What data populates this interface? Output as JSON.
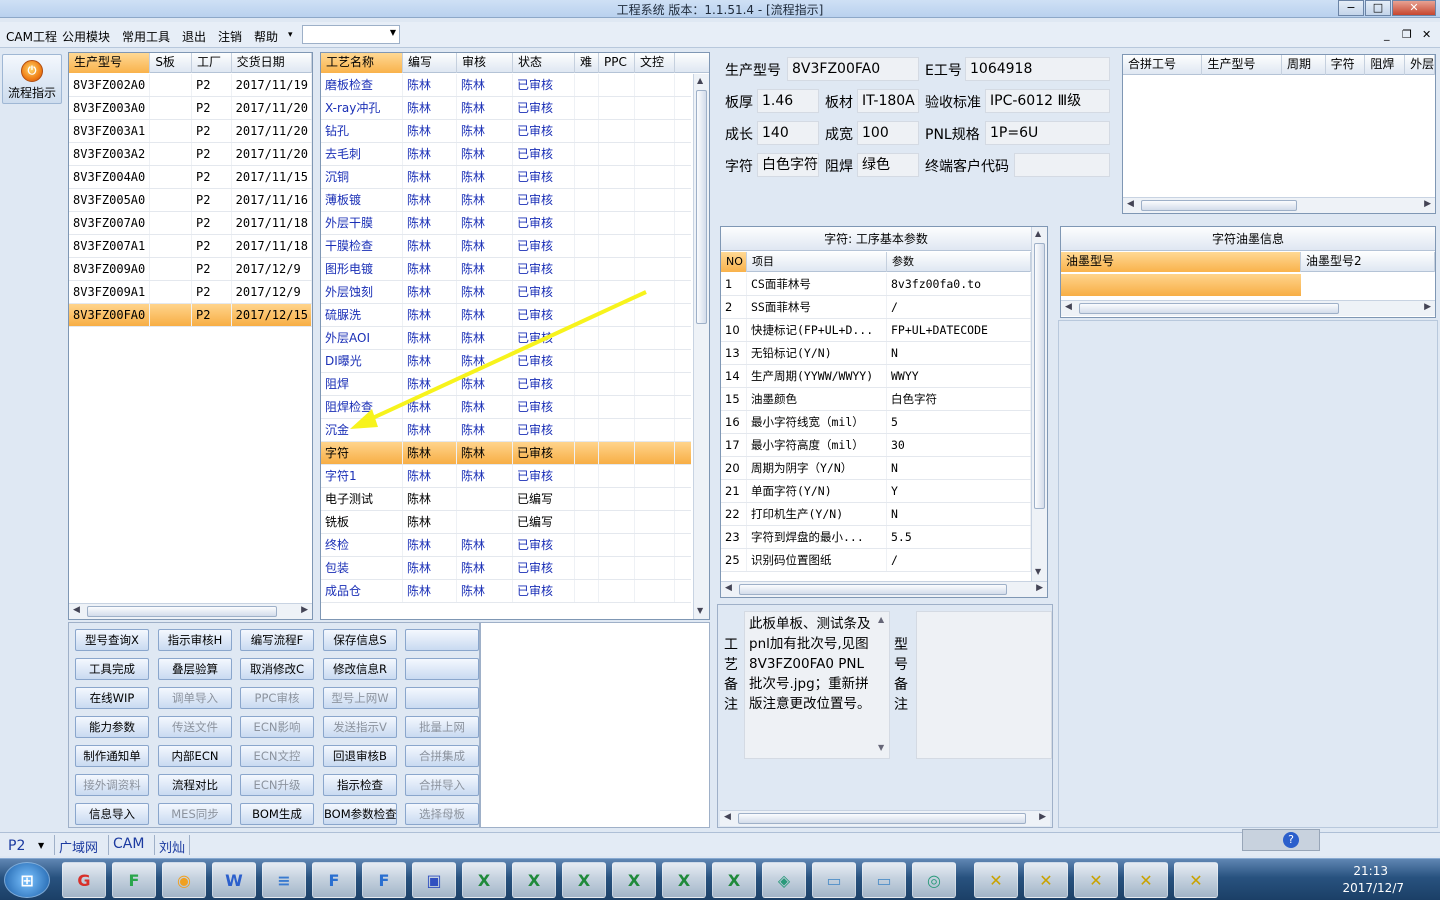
{
  "window": {
    "title": "工程系统    版本：1.1.51.4 - [流程指示]",
    "btn_min": "−",
    "btn_max": "□",
    "btn_close": "✕"
  },
  "menu": {
    "items": [
      "CAM工程",
      "公用模块",
      "常用工具",
      "退出",
      "注销",
      "帮助"
    ],
    "help_arrow": "▾",
    "combo_value": "",
    "mdi_min": "_",
    "mdi_restore": "❐",
    "mdi_close": "✕"
  },
  "nav": {
    "flow_label": "流程指示",
    "flow_icon": "flow-indicator-icon"
  },
  "models": {
    "headers": [
      "生产型号",
      "S板",
      "工厂",
      "交货日期"
    ],
    "rows": [
      [
        "8V3FZ002A0",
        "",
        "P2",
        "2017/11/19"
      ],
      [
        "8V3FZ003A0",
        "",
        "P2",
        "2017/11/20"
      ],
      [
        "8V3FZ003A1",
        "",
        "P2",
        "2017/11/20"
      ],
      [
        "8V3FZ003A2",
        "",
        "P2",
        "2017/11/20"
      ],
      [
        "8V3FZ004A0",
        "",
        "P2",
        "2017/11/15"
      ],
      [
        "8V3FZ005A0",
        "",
        "P2",
        "2017/11/16"
      ],
      [
        "8V3FZ007A0",
        "",
        "P2",
        "2017/11/18"
      ],
      [
        "8V3FZ007A1",
        "",
        "P2",
        "2017/11/18"
      ],
      [
        "8V3FZ009A0",
        "",
        "P2",
        "2017/12/9"
      ],
      [
        "8V3FZ009A1",
        "",
        "P2",
        "2017/12/9"
      ],
      [
        "8V3FZ00FA0",
        "",
        "P2",
        "2017/12/15"
      ]
    ],
    "selected_index": 10
  },
  "process": {
    "headers": [
      "工艺名称",
      "编写",
      "审核",
      "状态",
      "难",
      "PPC",
      "文控"
    ],
    "rows": [
      [
        "磨板检查",
        "陈林",
        "陈林",
        "已审核"
      ],
      [
        "X-ray冲孔",
        "陈林",
        "陈林",
        "已审核"
      ],
      [
        "钻孔",
        "陈林",
        "陈林",
        "已审核"
      ],
      [
        "去毛刺",
        "陈林",
        "陈林",
        "已审核"
      ],
      [
        "沉铜",
        "陈林",
        "陈林",
        "已审核"
      ],
      [
        "薄板镀",
        "陈林",
        "陈林",
        "已审核"
      ],
      [
        "外层干膜",
        "陈林",
        "陈林",
        "已审核"
      ],
      [
        "干膜检查",
        "陈林",
        "陈林",
        "已审核"
      ],
      [
        "图形电镀",
        "陈林",
        "陈林",
        "已审核"
      ],
      [
        "外层蚀刻",
        "陈林",
        "陈林",
        "已审核"
      ],
      [
        "硫脲洗",
        "陈林",
        "陈林",
        "已审核"
      ],
      [
        "外层AOI",
        "陈林",
        "陈林",
        "已审核"
      ],
      [
        "DI曝光",
        "陈林",
        "陈林",
        "已审核"
      ],
      [
        "阻焊",
        "陈林",
        "陈林",
        "已审核"
      ],
      [
        "阻焊检查",
        "陈林",
        "陈林",
        "已审核"
      ],
      [
        "沉金",
        "陈林",
        "陈林",
        "已审核"
      ],
      [
        "字符",
        "陈林",
        "陈林",
        "已审核"
      ],
      [
        "字符1",
        "陈林",
        "陈林",
        "已审核"
      ],
      [
        "电子测试",
        "陈林",
        "",
        "已编写"
      ],
      [
        "铣板",
        "陈林",
        "",
        "已编写"
      ],
      [
        "终检",
        "陈林",
        "陈林",
        "已审核"
      ],
      [
        "包装",
        "陈林",
        "陈林",
        "已审核"
      ],
      [
        "成品仓",
        "陈林",
        "陈林",
        "已审核"
      ]
    ],
    "selected_index": 16,
    "black_name_indices": [
      18,
      19
    ]
  },
  "buttons": [
    [
      "型号查询X",
      "指示审核H",
      "编写流程F",
      "保存信息S",
      ""
    ],
    [
      "工具完成",
      "叠层验算",
      "取消修改C",
      "修改信息R",
      ""
    ],
    [
      "在线WIP",
      "调单导入",
      "PPC审核",
      "型号上网W",
      ""
    ],
    [
      "能力参数",
      "传送文件",
      "ECN影响",
      "发送指示V",
      "批量上网"
    ],
    [
      "制作通知单",
      "内部ECN",
      "ECN文控",
      "回退审核B",
      "合拼集成"
    ],
    [
      "接外调资料",
      "流程对比",
      "ECN升级",
      "指示检查",
      "合拼导入"
    ],
    [
      "信息导入",
      "MES同步",
      "BOM生成",
      "BOM参数检查",
      "选择母板"
    ]
  ],
  "disabled_buttons": [
    "调单导入",
    "PPC审核",
    "型号上网W",
    "传送文件",
    "ECN影响",
    "发送指示V",
    "批量上网",
    "ECN文控",
    "合拼集成",
    "接外调资料",
    "ECN升级",
    "合拼导入",
    "MES同步",
    "选择母板"
  ],
  "info": {
    "model_label": "生产型号",
    "model": "8V3FZ00FA0",
    "eno_label": "E工号",
    "eno": "1064918",
    "thick_label": "板厚",
    "thick": "1.46",
    "mat_label": "板材",
    "mat": "IT-180A",
    "std_label": "验收标准",
    "std": "IPC-6012 Ⅲ级",
    "len_label": "成长",
    "len": "140",
    "wid_label": "成宽",
    "wid": "100",
    "pnl_label": "PNL规格",
    "pnl": "1P=6U",
    "char_label": "字符",
    "char": "白色字符",
    "mask_label": "阻焊",
    "mask": "绿色",
    "cust_label": "终端客户代码",
    "cust": ""
  },
  "merge": {
    "headers": [
      "合拼工号",
      "生产型号",
      "周期",
      "字符",
      "阻焊",
      "外层"
    ]
  },
  "params": {
    "title": "字符: 工序基本参数",
    "headers": [
      "NO",
      "项目",
      "参数"
    ],
    "rows": [
      [
        "1",
        "CS面菲林号",
        "8v3fz00fa0.to"
      ],
      [
        "2",
        "SS面菲林号",
        "/"
      ],
      [
        "10",
        "快捷标记(FP+UL+D...",
        "FP+UL+DATECODE"
      ],
      [
        "13",
        "无铅标记(Y/N)",
        "N"
      ],
      [
        "14",
        "生产周期(YYWW/WWYY)",
        "WWYY"
      ],
      [
        "15",
        "油墨颜色",
        "白色字符"
      ],
      [
        "16",
        "最小字符线宽（mil）",
        "5"
      ],
      [
        "17",
        "最小字符高度（mil）",
        "30"
      ],
      [
        "20",
        "周期为阴字（Y/N）",
        "N"
      ],
      [
        "21",
        "单面字符(Y/N)",
        "Y"
      ],
      [
        "22",
        "打印机生产(Y/N)",
        "N"
      ],
      [
        "23",
        "字符到焊盘的最小...",
        "5.5"
      ],
      [
        "25",
        "识别码位置图纸",
        "/"
      ]
    ]
  },
  "ink": {
    "title": "字符油墨信息",
    "headers": [
      "油墨型号",
      "油墨型号2"
    ]
  },
  "remarks": {
    "process_label": "工艺备注",
    "process_text": "此板单板、测试条及pnl加有批次号,见图8V3FZ00FA0 PNL批次号.jpg；重新拼版注意更改位置号。",
    "model_label": "型号备注",
    "model_text": ""
  },
  "status": {
    "factory": "P2",
    "items": [
      "广域网",
      "CAM",
      "刘灿"
    ]
  },
  "taskbar": {
    "time": "21:13",
    "date": "2017/12/7",
    "apps": [
      "start-orb",
      "chrome",
      "app-f-green",
      "shell",
      "word",
      "notepad",
      "foxmail",
      "foxmail2",
      "save-disk",
      "excel1",
      "excel2",
      "excel3",
      "excel4",
      "excel5",
      "excel6",
      "network",
      "photo1",
      "photo2",
      "eye",
      "x1",
      "x2",
      "x3",
      "x4",
      "x5"
    ]
  }
}
